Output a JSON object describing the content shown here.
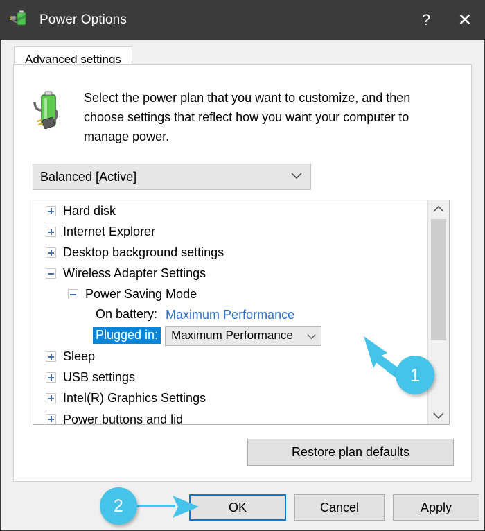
{
  "window": {
    "title": "Power Options",
    "icon": "power-plug-battery-icon",
    "help_label": "?",
    "close_label": "✕",
    "titlebar_color": "#3b3b3b"
  },
  "tab": {
    "label": "Advanced settings"
  },
  "header": {
    "icon": "battery-plug-icon",
    "instruction": "Select the power plan that you want to customize, and then choose settings that reflect how you want your computer to manage power."
  },
  "plan_select": {
    "value": "Balanced [Active]",
    "chevron": "⌄",
    "options": [
      "Balanced [Active]"
    ]
  },
  "tree": {
    "rows": [
      {
        "kind": "node",
        "level": 0,
        "expander": "plus",
        "label": "Hard disk"
      },
      {
        "kind": "node",
        "level": 0,
        "expander": "plus",
        "label": "Internet Explorer"
      },
      {
        "kind": "node",
        "level": 0,
        "expander": "plus",
        "label": "Desktop background settings"
      },
      {
        "kind": "node",
        "level": 0,
        "expander": "minus",
        "label": "Wireless Adapter Settings"
      },
      {
        "kind": "node",
        "level": 1,
        "expander": "minus",
        "label": "Power Saving Mode"
      },
      {
        "kind": "setting-link",
        "level": 2,
        "label": "On battery:",
        "value": "Maximum Performance"
      },
      {
        "kind": "setting-combo",
        "level": 2,
        "label": "Plugged in:",
        "value": "Maximum Performance",
        "selected": true
      },
      {
        "kind": "node",
        "level": 0,
        "expander": "plus",
        "label": "Sleep"
      },
      {
        "kind": "node",
        "level": 0,
        "expander": "plus",
        "label": "USB settings"
      },
      {
        "kind": "node",
        "level": 0,
        "expander": "plus",
        "label": "Intel(R) Graphics Settings"
      },
      {
        "kind": "node",
        "level": 0,
        "expander": "plus",
        "label": "Power buttons and lid",
        "clipped": true
      }
    ],
    "scrollbar": {
      "up_arrow": "⌃",
      "down_arrow": "⌄"
    }
  },
  "buttons": {
    "restore": "Restore plan defaults",
    "ok": "OK",
    "cancel": "Cancel",
    "apply": "Apply"
  },
  "annotations": {
    "color": "#45c3e8",
    "markers": [
      {
        "number": "1",
        "target": "plugged-in-dropdown"
      },
      {
        "number": "2",
        "target": "ok-button"
      }
    ]
  },
  "colors": {
    "selection_blue": "#0b85d8",
    "link_blue": "#2b6fd4",
    "focus_blue": "#0b78d0"
  }
}
